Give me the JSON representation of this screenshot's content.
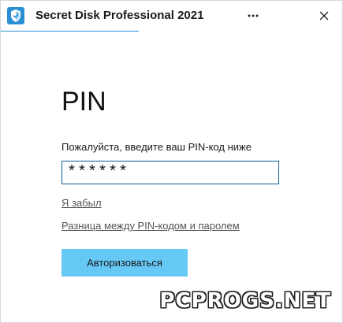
{
  "window": {
    "title": "Secret Disk Professional 2021",
    "icons": {
      "app": "shield-icon",
      "menu": "more-vertical-icon",
      "close": "close-icon"
    },
    "accent_color": "#2b8fd6"
  },
  "main": {
    "heading": "PIN",
    "prompt": "Пожалуйста, введите ваш PIN-код ниже",
    "pin_value": "******",
    "forgot_link": "Я забыл",
    "difference_link": "Разница между PIN-кодом и паролем",
    "auth_button": "Авторизоваться",
    "button_color": "#66c8f5"
  },
  "watermark": {
    "text": "PCPROGS.NET"
  }
}
